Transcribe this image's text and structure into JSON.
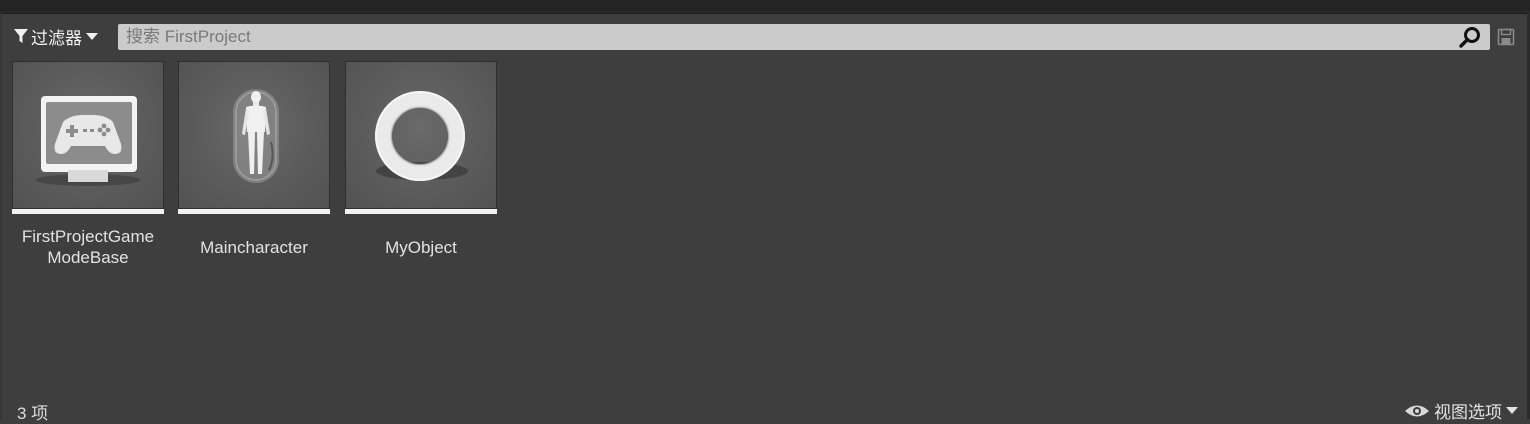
{
  "toolbar": {
    "filter_label": "过滤器",
    "search_placeholder": "搜索 FirstProject",
    "search_value": ""
  },
  "assets": [
    {
      "label_line1": "FirstProjectGame",
      "label_line2": "ModeBase",
      "icon": "gamepad-monitor-icon"
    },
    {
      "label_line1": "Maincharacter",
      "label_line2": "",
      "icon": "character-capsule-icon"
    },
    {
      "label_line1": "MyObject",
      "label_line2": "",
      "icon": "torus-icon"
    }
  ],
  "status": {
    "count": "3 项",
    "view_options": "视图选项"
  },
  "colors": {
    "background": "#3e3e3e",
    "tile_bar": "#f2f2f2",
    "search_bg": "#cbcbcb"
  }
}
